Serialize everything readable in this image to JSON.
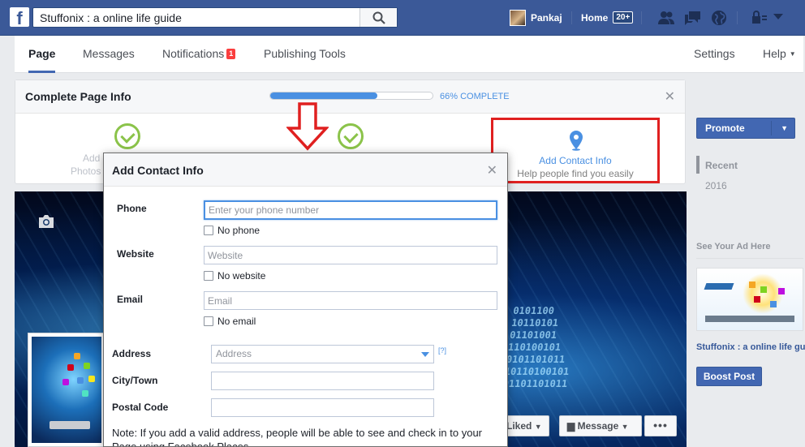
{
  "topbar": {
    "logo": "f",
    "search_value": "Stuffonix : a online life guide",
    "user_name": "Pankaj",
    "home_label": "Home",
    "home_badge": "20+",
    "icons": [
      "search-icon",
      "friend-requests-icon",
      "messages-icon",
      "notifications-globe-icon",
      "privacy-lock-icon",
      "account-menu-icon"
    ]
  },
  "tabs": {
    "items": [
      {
        "label": "Page"
      },
      {
        "label": "Messages"
      },
      {
        "label": "Notifications",
        "badge": "1"
      },
      {
        "label": "Publishing Tools"
      }
    ],
    "settings": "Settings",
    "help": "Help"
  },
  "complete_info": {
    "title": "Complete Page Info",
    "progress_fraction": 0.66,
    "progress_text": "66% COMPLETE",
    "faded_label_1a": "Add",
    "faded_label_1b": "Photos",
    "contact_title": "Add Contact Info",
    "contact_sub": "Help people find you easily"
  },
  "modal": {
    "title": "Add Contact Info",
    "phone_label": "Phone",
    "phone_placeholder": "Enter your phone number",
    "no_phone": "No phone",
    "website_label": "Website",
    "website_placeholder": "Website",
    "no_website": "No website",
    "email_label": "Email",
    "email_placeholder": "Email",
    "no_email": "No email",
    "address_label": "Address",
    "address_placeholder": "Address",
    "address_help": "[?]",
    "city_label": "City/Town",
    "postal_label": "Postal Code",
    "note": "Note: If you add a valid address, people will be able to see and check in to your Page using Facebook Places."
  },
  "cover": {
    "binary": "0101100\n10110101\n01101001\n110100101\n0101101011\n10110100101\n01101101011",
    "liked_label": "Liked",
    "message_label": "Message",
    "more_label": "•••"
  },
  "sidebar": {
    "promote": "Promote",
    "recent": "Recent",
    "year": "2016",
    "ad_heading": "See Your Ad Here",
    "ad_title": "Stuffonix : a online life guide",
    "boost": "Boost Post"
  },
  "colors": {
    "brand": "#3b5998",
    "accent": "#4267b2",
    "progress": "#4a90e2",
    "highlight_border": "#e02020"
  }
}
